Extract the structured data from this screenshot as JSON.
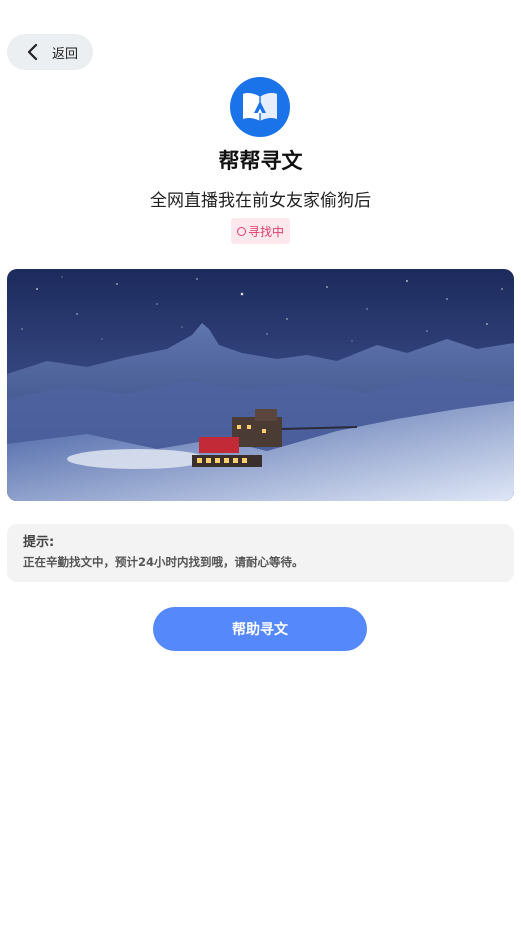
{
  "header": {
    "back_label": "返回",
    "back_icon": "chevron-left-icon"
  },
  "app": {
    "logo_icon": "open-book-icon",
    "title": "帮帮寻文"
  },
  "book": {
    "title": "全网直播我在前女友家偷狗后"
  },
  "status": {
    "label": "寻找中",
    "icon": "loading-circle-icon",
    "color": "#e23b6a",
    "background": "#fde8ee"
  },
  "banner": {
    "description_icon": "mountain-night-train-image"
  },
  "tip": {
    "title": "提示:",
    "text": "正在辛勤找文中，预计24小时内找到哦，请耐心等待。"
  },
  "actions": {
    "help_label": "帮助寻文",
    "help_color": "#5589fb"
  },
  "colors": {
    "accent": "#1a73e8",
    "background": "#ffffff"
  }
}
